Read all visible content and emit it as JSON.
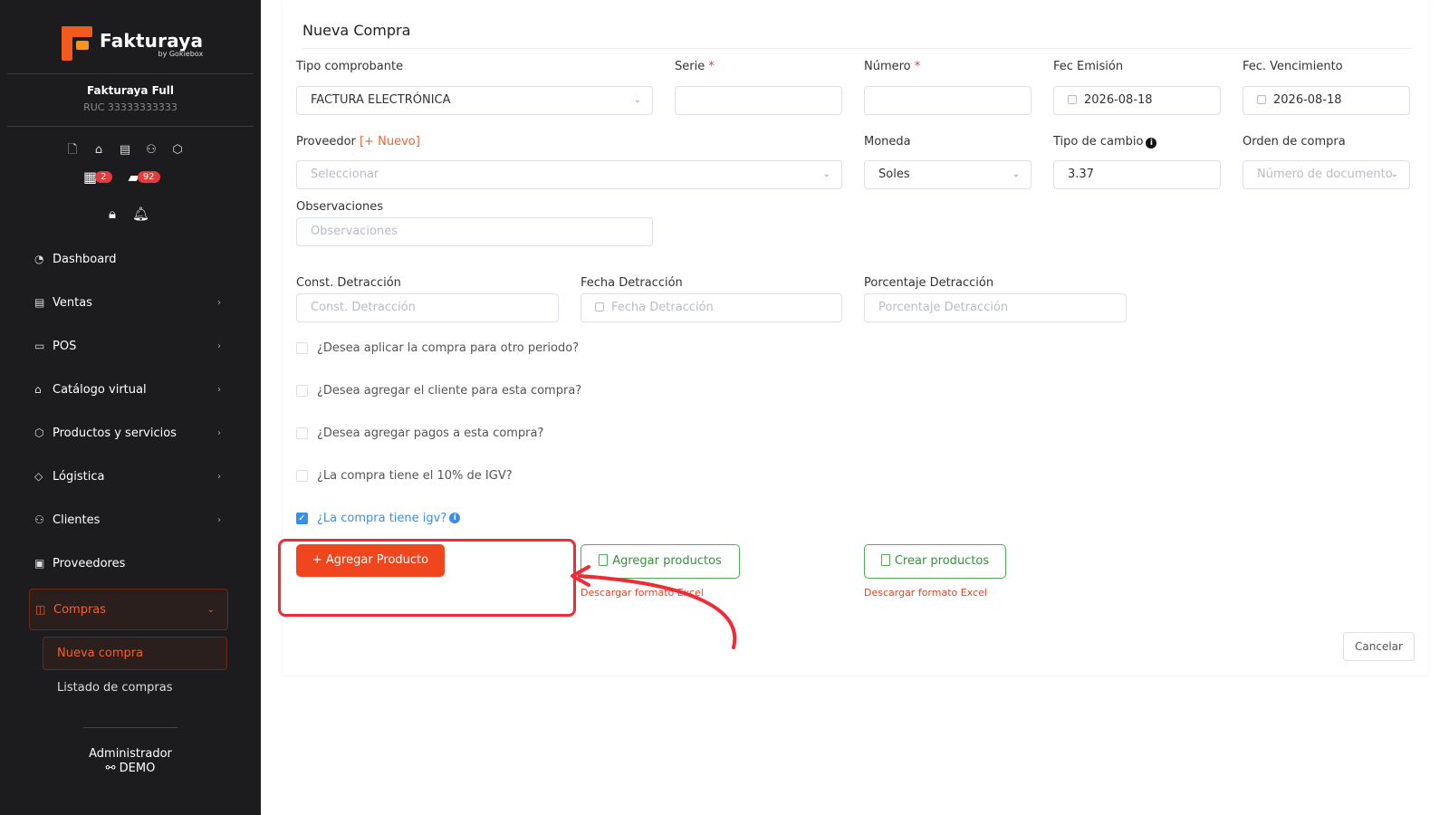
{
  "sidebar": {
    "logo_title": "Fakturaya",
    "logo_sub": "by Gokiebox",
    "company": "Fakturaya Full",
    "ruc": "RUC 33333333333",
    "badges": [
      "2",
      "92"
    ],
    "items": [
      {
        "label": "Dashboard",
        "icon": "dashboard-icon"
      },
      {
        "label": "Ventas",
        "icon": "receipt-icon"
      },
      {
        "label": "POS",
        "icon": "monitor-icon"
      },
      {
        "label": "Catálogo virtual",
        "icon": "store-icon"
      },
      {
        "label": "Productos y servicios",
        "icon": "box-icon"
      },
      {
        "label": "Lógistica",
        "icon": "tag-icon"
      },
      {
        "label": "Clientes",
        "icon": "users-icon"
      },
      {
        "label": "Proveedores",
        "icon": "briefcase-icon"
      },
      {
        "label": "Compras",
        "icon": "bag-icon"
      }
    ],
    "sub_active": "Nueva compra",
    "sub_item": "Listado de compras",
    "admin_role": "Administrador",
    "admin_name": "DEMO"
  },
  "form": {
    "title": "Nueva Compra",
    "tipo_label": "Tipo comprobante",
    "tipo_value": "FACTURA ELECTRÓNICA",
    "serie_label": "Serie",
    "numero_label": "Número",
    "fec_emision_label": "Fec Emisión",
    "fec_emision_value": "2026-08-18",
    "fec_venc_label": "Fec. Vencimiento",
    "fec_venc_value": "2026-08-18",
    "proveedor_label": "Proveedor",
    "proveedor_new": "[+ Nuevo]",
    "proveedor_ph": "Seleccionar",
    "moneda_label": "Moneda",
    "moneda_value": "Soles",
    "cambio_label": "Tipo de cambio",
    "cambio_value": "3.37",
    "orden_label": "Orden de compra",
    "orden_ph": "Número de documento",
    "obs_label": "Observaciones",
    "obs_ph": "Observaciones",
    "const_label": "Const. Detracción",
    "const_ph": "Const. Detracción",
    "fecha_det_label": "Fecha Detracción",
    "fecha_det_ph": "Fecha Detracción",
    "porc_label": "Porcentaje Detracción",
    "porc_ph": "Porcentaje Detracción",
    "checks": [
      {
        "label": "¿Desea aplicar la compra para otro periodo?",
        "checked": false
      },
      {
        "label": "¿Desea agregar el cliente para esta compra?",
        "checked": false
      },
      {
        "label": "¿Desea agregar pagos a esta compra?",
        "checked": false
      },
      {
        "label": "¿La compra tiene el 10% de IGV?",
        "checked": false
      },
      {
        "label": "¿La compra tiene igv?",
        "checked": true
      }
    ],
    "add_product": "+ Agregar Producto",
    "add_products": "Agregar productos",
    "create_products": "Crear productos",
    "download_1": "Descargar formato Excel",
    "download_2": "Descargar formato Excel",
    "cancel": "Cancelar"
  },
  "colors": {
    "accent": "#f0461e",
    "sidebar_bg": "#1c1c1f",
    "highlight": "#ef2b37",
    "success": "#4caf50"
  }
}
